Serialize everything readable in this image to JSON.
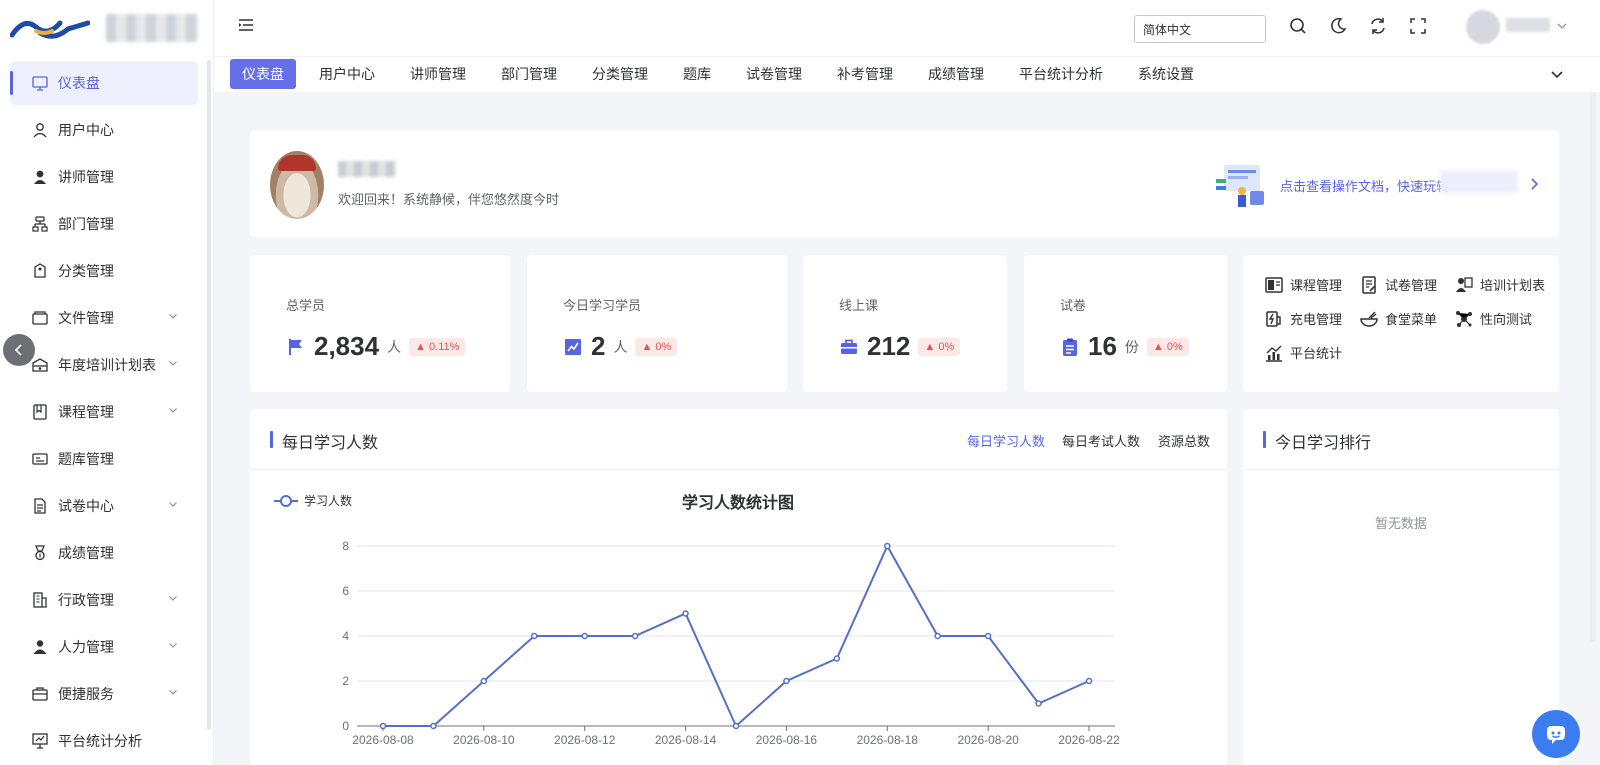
{
  "header": {
    "lang_value": "简体中文",
    "icons": [
      "search-icon",
      "moon-icon",
      "refresh-icon",
      "fullscreen-icon"
    ]
  },
  "sidebar": {
    "items": [
      {
        "label": "仪表盘",
        "icon": "monitor-icon",
        "active": true,
        "has_arrow": false
      },
      {
        "label": "用户中心",
        "icon": "user-outline-icon",
        "has_arrow": false
      },
      {
        "label": "讲师管理",
        "icon": "user-solid-icon",
        "has_arrow": false
      },
      {
        "label": "部门管理",
        "icon": "org-icon",
        "has_arrow": false
      },
      {
        "label": "分类管理",
        "icon": "category-icon",
        "has_arrow": false
      },
      {
        "label": "文件管理",
        "icon": "folder-icon",
        "has_arrow": true
      },
      {
        "label": "年度培训计划表",
        "icon": "box-icon",
        "has_arrow": true
      },
      {
        "label": "课程管理",
        "icon": "book-icon",
        "has_arrow": true
      },
      {
        "label": "题库管理",
        "icon": "bank-icon",
        "has_arrow": false
      },
      {
        "label": "试卷中心",
        "icon": "paper-icon",
        "has_arrow": true
      },
      {
        "label": "成绩管理",
        "icon": "medal-icon",
        "has_arrow": false
      },
      {
        "label": "行政管理",
        "icon": "building-icon",
        "has_arrow": true
      },
      {
        "label": "人力管理",
        "icon": "person-icon",
        "has_arrow": true
      },
      {
        "label": "便捷服务",
        "icon": "briefcase-icon",
        "has_arrow": true
      },
      {
        "label": "平台统计分析",
        "icon": "stats-icon",
        "has_arrow": false
      }
    ]
  },
  "tabs": [
    "仪表盘",
    "用户中心",
    "讲师管理",
    "部门管理",
    "分类管理",
    "题库",
    "试卷管理",
    "补考管理",
    "成绩管理",
    "平台统计分析",
    "系统设置"
  ],
  "welcome": {
    "text": "欢迎回来！系统静候，伴您悠然度今时",
    "doc_link": "点击查看操作文档，快速玩转"
  },
  "stats": [
    {
      "label": "总学员",
      "value": "2,834",
      "unit": "人",
      "badge": "▲ 0.11%",
      "icon": "flag-icon"
    },
    {
      "label": "今日学习学员",
      "value": "2",
      "unit": "人",
      "badge": "▲ 0%",
      "icon": "trend-icon"
    },
    {
      "label": "线上课",
      "value": "212",
      "unit": "",
      "badge": "▲ 0%",
      "icon": "briefcase-icon"
    },
    {
      "label": "试卷",
      "value": "16",
      "unit": "份",
      "badge": "▲ 0%",
      "icon": "clipboard-icon"
    }
  ],
  "shortcuts": [
    {
      "label": "课程管理",
      "icon": "course-icon"
    },
    {
      "label": "试卷管理",
      "icon": "exam-icon"
    },
    {
      "label": "培训计划表",
      "icon": "training-icon"
    },
    {
      "label": "充电管理",
      "icon": "charge-icon"
    },
    {
      "label": "食堂菜单",
      "icon": "bowl-icon"
    },
    {
      "label": "性向测试",
      "icon": "molecule-icon"
    },
    {
      "label": "平台统计",
      "icon": "bar-chart-icon"
    }
  ],
  "chart_card": {
    "title": "每日学习人数",
    "tabs": [
      "每日学习人数",
      "每日考试人数",
      "资源总数"
    ]
  },
  "rank_card": {
    "title": "今日学习排行",
    "empty": "暂无数据"
  },
  "colors": {
    "accent": "#5964e0",
    "line": "#5470c6",
    "badge_bg": "#fde8e8",
    "badge_text": "#e05555"
  },
  "chart_data": {
    "type": "line",
    "title": "学习人数统计图",
    "series": [
      {
        "name": "学习人数",
        "values": [
          0,
          0,
          2,
          4,
          4,
          4,
          5,
          0,
          2,
          3,
          8,
          4,
          4,
          1,
          2
        ]
      }
    ],
    "x": [
      "2026-08-08",
      "2026-08-09",
      "2026-08-10",
      "2026-08-11",
      "2026-08-12",
      "2026-08-13",
      "2026-08-14",
      "2026-08-15",
      "2026-08-16",
      "2026-08-17",
      "2026-08-18",
      "2026-08-19",
      "2026-08-20",
      "2026-08-21",
      "2026-08-22"
    ],
    "x_tick_labels": [
      "2026-08-08",
      "2026-08-10",
      "2026-08-12",
      "2026-08-14",
      "2026-08-16",
      "2026-08-18",
      "2026-08-20",
      "2026-08-22"
    ],
    "y_ticks": [
      0,
      2,
      4,
      6,
      8
    ],
    "ylim": [
      0,
      8
    ],
    "grid": true,
    "legend": "top-left"
  }
}
